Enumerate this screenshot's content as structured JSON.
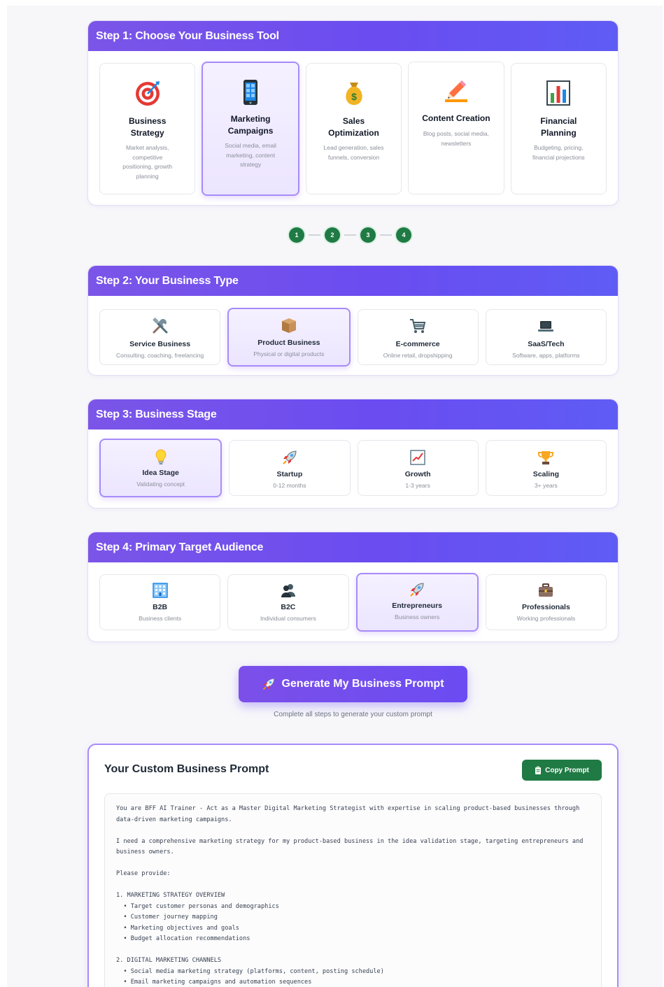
{
  "step1": {
    "header": "Step 1: Choose Your Business Tool",
    "tools": [
      {
        "icon": "target-icon",
        "title": "Business Strategy",
        "desc": "Market analysis, competitive positioning, growth planning",
        "selected": false
      },
      {
        "icon": "smartphone-icon",
        "title": "Marketing Campaigns",
        "desc": "Social media, email marketing, content strategy",
        "selected": true
      },
      {
        "icon": "money-bag-icon",
        "title": "Sales Optimization",
        "desc": "Lead generation, sales funnels, conversion",
        "selected": false
      },
      {
        "icon": "pencil-icon",
        "title": "Content Creation",
        "desc": "Blog posts, social media, newsletters",
        "selected": false
      },
      {
        "icon": "bar-chart-icon",
        "title": "Financial Planning",
        "desc": "Budgeting, pricing, financial projections",
        "selected": false
      }
    ]
  },
  "progress": {
    "steps": [
      "1",
      "2",
      "3",
      "4"
    ]
  },
  "step2": {
    "header": "Step 2: Your Business Type",
    "options": [
      {
        "icon": "tools-icon",
        "title": "Service Business",
        "desc": "Consulting, coaching, freelancing",
        "selected": false
      },
      {
        "icon": "package-icon",
        "title": "Product Business",
        "desc": "Physical or digital products",
        "selected": true
      },
      {
        "icon": "shopping-cart-icon",
        "title": "E-commerce",
        "desc": "Online retail, dropshipping",
        "selected": false
      },
      {
        "icon": "laptop-icon",
        "title": "SaaS/Tech",
        "desc": "Software, apps, platforms",
        "selected": false
      }
    ]
  },
  "step3": {
    "header": "Step 3: Business Stage",
    "options": [
      {
        "icon": "lightbulb-icon",
        "title": "Idea Stage",
        "desc": "Validating concept",
        "selected": true
      },
      {
        "icon": "rocket-icon",
        "title": "Startup",
        "desc": "0-12 months",
        "selected": false
      },
      {
        "icon": "chart-up-icon",
        "title": "Growth",
        "desc": "1-3 years",
        "selected": false
      },
      {
        "icon": "trophy-icon",
        "title": "Scaling",
        "desc": "3+ years",
        "selected": false
      }
    ]
  },
  "step4": {
    "header": "Step 4: Primary Target Audience",
    "options": [
      {
        "icon": "office-building-icon",
        "title": "B2B",
        "desc": "Business clients",
        "selected": false
      },
      {
        "icon": "people-icon",
        "title": "B2C",
        "desc": "Individual consumers",
        "selected": false
      },
      {
        "icon": "rocket-icon",
        "title": "Entrepreneurs",
        "desc": "Business owners",
        "selected": true
      },
      {
        "icon": "briefcase-icon",
        "title": "Professionals",
        "desc": "Working professionals",
        "selected": false
      }
    ]
  },
  "generate": {
    "label": "Generate My Business Prompt",
    "hint": "Complete all steps to generate your custom prompt"
  },
  "result": {
    "title": "Your Custom Business Prompt",
    "copy_label": "Copy Prompt",
    "prompt": "You are BFF AI Trainer - Act as a Master Digital Marketing Strategist with expertise in scaling product-based businesses through\ndata-driven marketing campaigns.\n\nI need a comprehensive marketing strategy for my product-based business in the idea validation stage, targeting entrepreneurs and\nbusiness owners.\n\nPlease provide:\n\n1. MARKETING STRATEGY OVERVIEW\n  • Target customer personas and demographics\n  • Customer journey mapping\n  • Marketing objectives and goals\n  • Budget allocation recommendations\n\n2. DIGITAL MARKETING CHANNELS\n  • Social media marketing strategy (platforms, content, posting schedule)\n  • Email marketing campaigns and automation sequences\n  • Content marketing plan (blog, video, podcasts)"
  }
}
